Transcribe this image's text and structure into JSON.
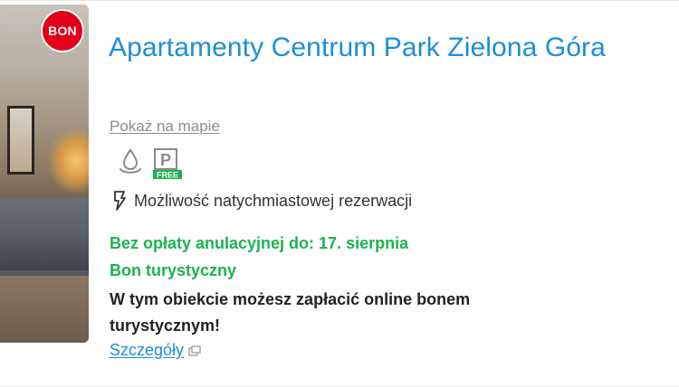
{
  "badge": {
    "label": "BON",
    "color": "#e2001a"
  },
  "listing": {
    "title": "Apartamenty Centrum Park Zielona Góra",
    "map_link": "Pokaż na mapie",
    "amenities": [
      {
        "icon": "water-drop-icon"
      },
      {
        "icon": "free-parking-icon",
        "letter": "P",
        "tag": "FREE"
      }
    ],
    "instant_booking": {
      "icon": "lightning-icon",
      "label": "Możliwość natychmiastowej rezerwacji"
    },
    "free_cancellation": "Bez opłaty anulacyjnej do: 17. sierpnia",
    "voucher_title": "Bon turystyczny",
    "voucher_desc": "W tym obiekcie możesz zapłacić online bonem turystycznym!",
    "details_link": {
      "label": "Szczegóły",
      "icon": "external-link-icon"
    }
  },
  "colors": {
    "link_blue": "#1c8ed8",
    "green": "#1db34f",
    "grey_link": "#8c8c8c"
  }
}
